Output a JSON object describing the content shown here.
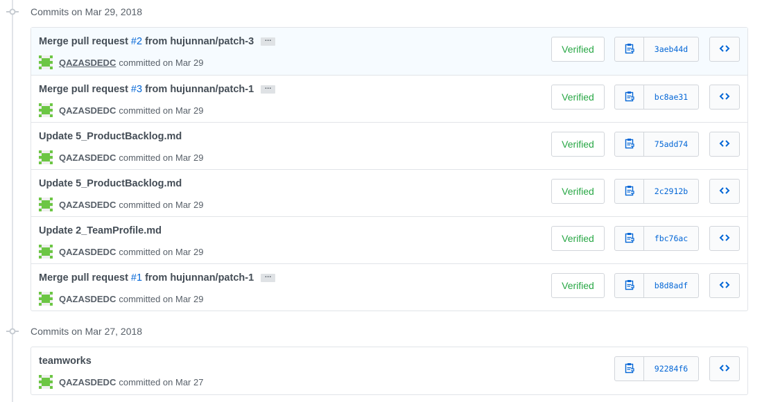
{
  "groups": [
    {
      "title": "Commits on Mar 29, 2018",
      "commits": [
        {
          "title_prefix": "Merge pull request",
          "title_link": "#2",
          "title_suffix": "from hujunnan/patch-3",
          "has_ellipsis": true,
          "ellipsis": "…",
          "author": "QAZASDEDC",
          "meta": "committed on Mar 29",
          "verified": "Verified",
          "sha": "3aeb44d",
          "highlight": true
        },
        {
          "title_prefix": "Merge pull request",
          "title_link": "#3",
          "title_suffix": "from hujunnan/patch-1",
          "has_ellipsis": true,
          "ellipsis": "…",
          "author": "QAZASDEDC",
          "meta": "committed on Mar 29",
          "verified": "Verified",
          "sha": "bc8ae31"
        },
        {
          "title_prefix": "Update 5_ProductBacklog.md",
          "title_link": "",
          "title_suffix": "",
          "has_ellipsis": false,
          "author": "QAZASDEDC",
          "meta": "committed on Mar 29",
          "verified": "Verified",
          "sha": "75add74"
        },
        {
          "title_prefix": "Update 5_ProductBacklog.md",
          "title_link": "",
          "title_suffix": "",
          "has_ellipsis": false,
          "author": "QAZASDEDC",
          "meta": "committed on Mar 29",
          "verified": "Verified",
          "sha": "2c2912b"
        },
        {
          "title_prefix": "Update 2_TeamProfile.md",
          "title_link": "",
          "title_suffix": "",
          "has_ellipsis": false,
          "author": "QAZASDEDC",
          "meta": "committed on Mar 29",
          "verified": "Verified",
          "sha": "fbc76ac"
        },
        {
          "title_prefix": "Merge pull request",
          "title_link": "#1",
          "title_suffix": "from hujunnan/patch-1",
          "has_ellipsis": true,
          "ellipsis": "…",
          "author": "QAZASDEDC",
          "meta": "committed on Mar 29",
          "verified": "Verified",
          "sha": "b8d8adf"
        }
      ]
    },
    {
      "title": "Commits on Mar 27, 2018",
      "commits": [
        {
          "title_prefix": "teamworks",
          "title_link": "",
          "title_suffix": "",
          "has_ellipsis": false,
          "author": "QAZASDEDC",
          "meta": "committed on Mar 27",
          "verified": "",
          "sha": "92284f6"
        }
      ]
    }
  ],
  "colors": {
    "verified": "#28a745",
    "link": "#0366d6",
    "avatar": "#6cc644"
  },
  "icons": {
    "group": "git-commit-icon",
    "copy": "clippy-icon",
    "browse": "code-icon",
    "avatar": "identicon"
  }
}
